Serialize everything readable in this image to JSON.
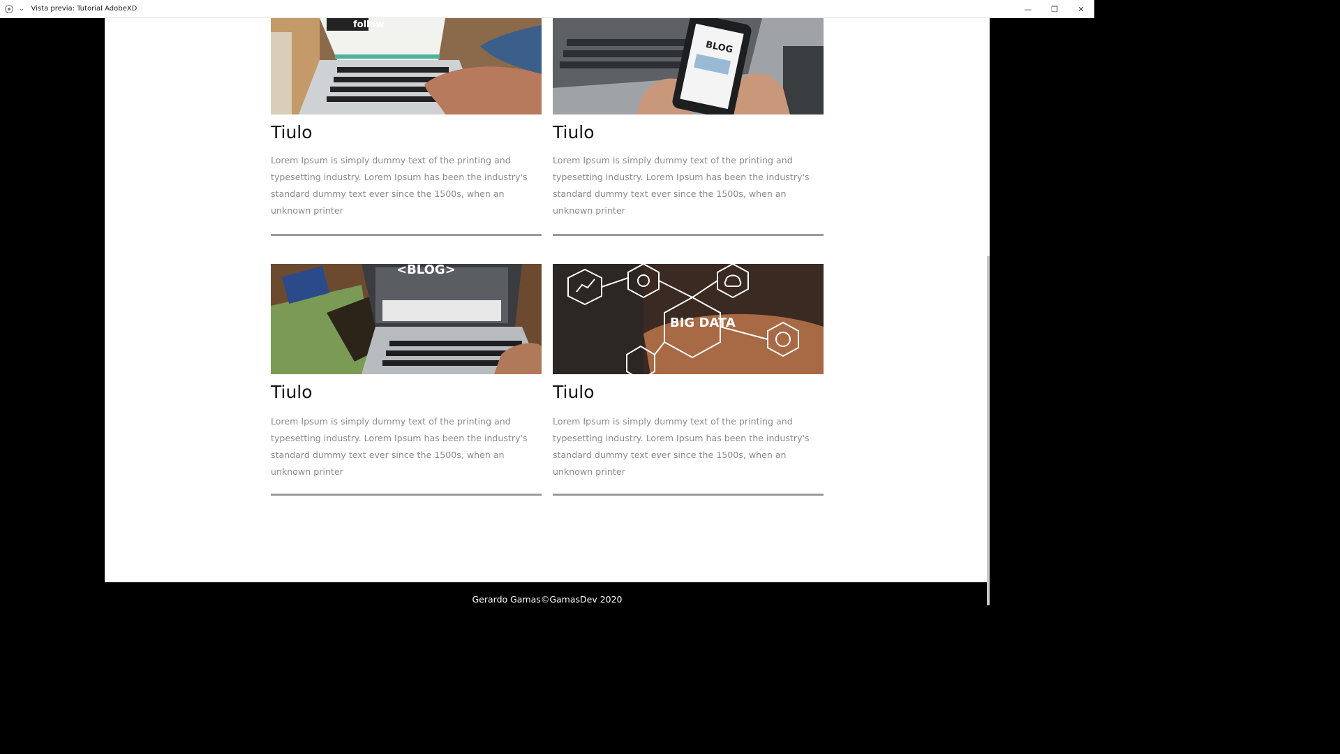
{
  "window": {
    "title": "Vista previa: Tutorial AdobeXD",
    "minimize_glyph": "—",
    "restore_glyph": "❐",
    "close_glyph": "✕"
  },
  "cards": [
    {
      "title": "Tiulo",
      "description": "Lorem Ipsum is simply dummy text of the printing and typesetting industry. Lorem Ipsum has been the industry's standard dummy text ever since the 1500s, when an unknown printer",
      "image": "laptop-typing-photo",
      "image_text": "follow"
    },
    {
      "title": "Tiulo",
      "description": "Lorem Ipsum is simply dummy text of the printing and typesetting industry. Lorem Ipsum has been the industry's standard dummy text ever since the 1500s, when an unknown printer",
      "image": "phone-blog-photo",
      "image_text": "BLOG"
    },
    {
      "title": "Tiulo",
      "description": "Lorem Ipsum is simply dummy text of the printing and typesetting industry. Lorem Ipsum has been the industry's standard dummy text ever since the 1500s, when an unknown printer",
      "image": "laptop-blog-desk-photo",
      "image_text": "<BLOG>"
    },
    {
      "title": "Tiulo",
      "description": "Lorem Ipsum is simply dummy text of the printing and typesetting industry. Lorem Ipsum has been the industry's standard dummy text ever since the 1500s, when an unknown printer",
      "image": "big-data-network-photo",
      "image_text": "BIG DATA"
    }
  ],
  "footer": {
    "text": "Gerardo Gamas©GamasDev 2020"
  }
}
